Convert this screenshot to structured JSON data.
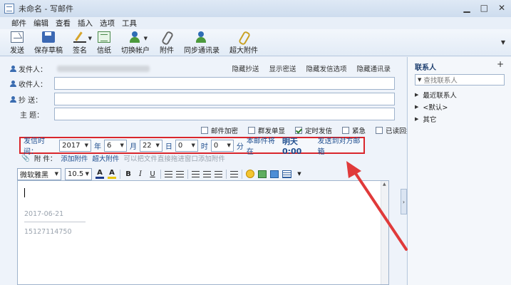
{
  "window": {
    "title": "未命名 - 写邮件",
    "minimize": "▁",
    "maximize": "□",
    "close": "✕"
  },
  "menu": [
    "邮件",
    "编辑",
    "查看",
    "插入",
    "选项",
    "工具"
  ],
  "toolbar": [
    {
      "label": "发送",
      "icon": "send-icon"
    },
    {
      "label": "保存草稿",
      "icon": "save-icon"
    },
    {
      "label": "签名",
      "icon": "signature-icon"
    },
    {
      "label": "信纸",
      "icon": "stationery-icon"
    },
    {
      "label": "切换帐户",
      "icon": "account-switch-icon"
    },
    {
      "label": "附件",
      "icon": "paperclip-icon"
    },
    {
      "label": "同步通讯录",
      "icon": "sync-contacts-icon"
    },
    {
      "label": "超大附件",
      "icon": "large-attachment-icon"
    }
  ],
  "header": {
    "from_label": "发件人：",
    "to_label": "收件人：",
    "cc_label": "抄  送：",
    "subject_label": "主  题：",
    "links": [
      "隐藏抄送",
      "显示密送",
      "隐藏发信选项",
      "隐藏通讯录"
    ]
  },
  "options": [
    {
      "label": "邮件加密",
      "checked": false
    },
    {
      "label": "群发单显",
      "checked": false
    },
    {
      "label": "定时发信",
      "checked": true
    },
    {
      "label": "紧急",
      "checked": false
    },
    {
      "label": "已读回执",
      "checked": false
    }
  ],
  "schedule": {
    "label": "发信时间：",
    "year": "2017",
    "year_unit": "年",
    "month": "6",
    "month_unit": "月",
    "day": "22",
    "day_unit": "日",
    "hour": "0",
    "hour_unit": "时",
    "minute": "0",
    "minute_unit": "分",
    "note_prefix": "本邮件将在",
    "note_time": "明天0:00",
    "note_suffix": "发送到对方邮箱"
  },
  "attach": {
    "label": "附  件：",
    "add": "添加附件",
    "large": "超大附件",
    "hint": "可以把文件直接拖进窗口添加附件"
  },
  "format": {
    "font": "微软雅黑",
    "size": "10.5"
  },
  "editor": {
    "date": "2017-06-21",
    "phone": "15127114750"
  },
  "sidebar": {
    "title": "联系人",
    "add": "+",
    "search_placeholder": "查找联系人",
    "tree": [
      "最近联系人",
      "<默认>",
      "其它"
    ]
  },
  "colors": {
    "highlight_border": "#d9262b",
    "link_blue": "#1f4e8f"
  }
}
